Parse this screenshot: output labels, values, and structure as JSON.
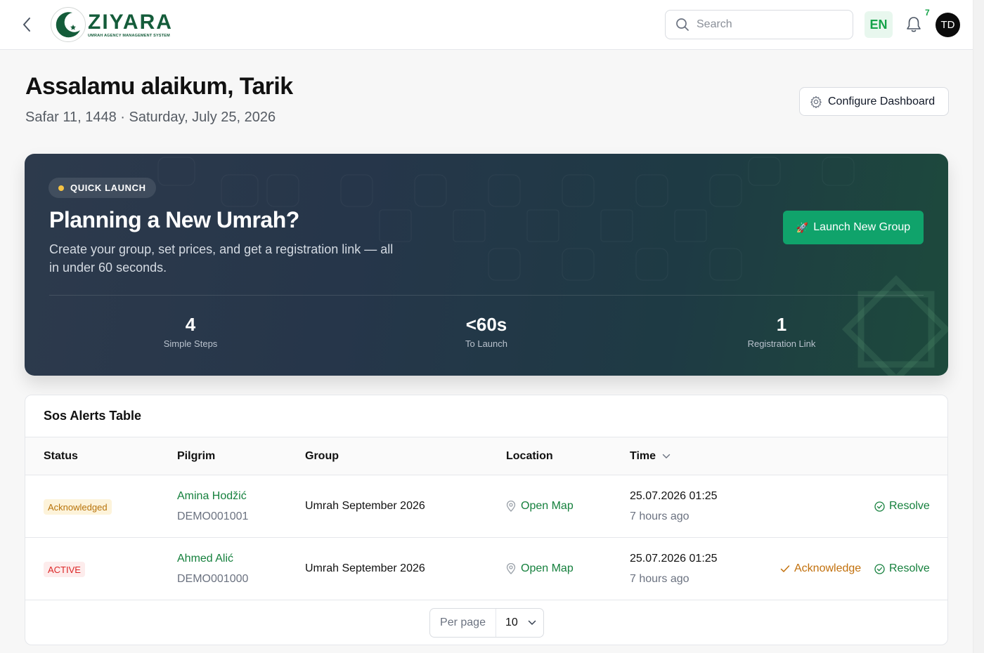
{
  "header": {
    "brand_name": "ZIYARA",
    "brand_tagline": "UMRAH AGENCY MANAGEMENT SYSTEM",
    "search_placeholder": "Search",
    "language": "EN",
    "notification_count": "7",
    "avatar_initials": "TD",
    "icons": [
      "chevron-left-icon",
      "crescent-star-logo",
      "search-icon",
      "bell-icon"
    ]
  },
  "greeting": {
    "title": "Assalamu alaikum, Tarik",
    "date": "Safar 11, 1448 · Saturday, July 25, 2026",
    "configure_label": "Configure Dashboard"
  },
  "hero": {
    "pill": "QUICK LAUNCH",
    "title": "Planning a New Umrah?",
    "description": "Create your group, set prices, and get a registration link — all in under 60 seconds.",
    "button_label": "Launch New Group",
    "button_icon": "🚀",
    "stats": [
      {
        "value": "4",
        "label": "Simple Steps"
      },
      {
        "value": "<60s",
        "label": "To Launch"
      },
      {
        "value": "1",
        "label": "Registration Link"
      }
    ]
  },
  "sos_table": {
    "title": "Sos Alerts Table",
    "columns": [
      "Status",
      "Pilgrim",
      "Group",
      "Location",
      "Time"
    ],
    "rows": [
      {
        "status": "Acknowledged",
        "status_color": "#b8730a",
        "pilgrim": "Amina Hodžić",
        "pilgrim_id": "DEMO001001",
        "group": "Umrah September 2026",
        "location": "Open Map",
        "time": "25.07.2026 01:25",
        "ago": "7 hours ago",
        "actions": [
          "Resolve"
        ]
      },
      {
        "status": "ACTIVE",
        "status_color": "#dc2626",
        "pilgrim": "Ahmed Alić",
        "pilgrim_id": "DEMO001000",
        "group": "Umrah September 2026",
        "location": "Open Map",
        "time": "25.07.2026 01:25",
        "ago": "7 hours ago",
        "actions": [
          "Acknowledge",
          "Resolve"
        ]
      }
    ],
    "per_page_label": "Per page",
    "per_page_value": "10"
  },
  "colors": {
    "brand_green": "#145c3a",
    "accent_green": "#10a36b",
    "link_green": "#15803d",
    "warning": "#c2700c",
    "danger": "#dc2626"
  }
}
